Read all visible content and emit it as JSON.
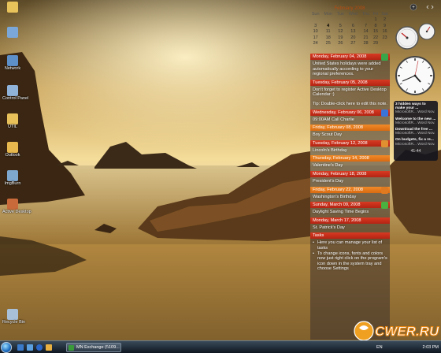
{
  "desktop_icons": [
    {
      "label": "",
      "icon": "user-folder-icon",
      "color": "#e8c25a"
    },
    {
      "label": "",
      "icon": "computer-icon",
      "color": "#7aa7d8"
    },
    {
      "label": "Network",
      "icon": "network-icon",
      "color": "#5d8fc9"
    },
    {
      "label": "Control Panel",
      "icon": "control-panel-icon",
      "color": "#8fb3d9"
    },
    {
      "label": "UTIL",
      "icon": "folder-icon",
      "color": "#e9c15b"
    },
    {
      "label": "Outlook",
      "icon": "outlook-icon",
      "color": "#e6b84e"
    },
    {
      "label": "ImgBurn",
      "icon": "imgburn-icon",
      "color": "#7fa8cf"
    },
    {
      "label": "Active Desktop",
      "icon": "calendar-app-icon",
      "color": "#c86a3a"
    },
    {
      "label": "Recycle Bin",
      "icon": "recycle-bin-icon",
      "color": "#a8c0d8"
    }
  ],
  "calendar": {
    "month_title": "February 2008",
    "weekdays": [
      "Sun",
      "Mon",
      "Tue",
      "Wed",
      "Thu",
      "Fri",
      "Sat"
    ],
    "weeks": [
      [
        "",
        "",
        "",
        "",
        "",
        "1",
        "2"
      ],
      [
        "3",
        "4",
        "5",
        "6",
        "7",
        "8",
        "9"
      ],
      [
        "10",
        "11",
        "12",
        "13",
        "14",
        "15",
        "16"
      ],
      [
        "17",
        "18",
        "19",
        "20",
        "21",
        "22",
        "23"
      ],
      [
        "24",
        "25",
        "26",
        "27",
        "28",
        "29",
        ""
      ]
    ]
  },
  "events": [
    {
      "header": "Monday, February 04, 2008",
      "style": "red",
      "icon_color": "#3aa64a",
      "body": "United States holidays were added automatically according to your regional preferences."
    },
    {
      "header": "Tuesday, February 05, 2008",
      "style": "red",
      "icon_color": "",
      "body": "Don't forget to register Active Desktop Calendar :)"
    },
    {
      "header": "",
      "style": "none",
      "icon_color": "",
      "body": "Tip: Double-click here to edit this note."
    },
    {
      "header": "Wednesday, February 06, 2008",
      "style": "red",
      "icon_color": "#3a74d8",
      "body": "09:00AM Call Charlie"
    },
    {
      "header": "Friday, February 08, 2008",
      "style": "orange",
      "icon_color": "",
      "body": "Boy Scout Day"
    },
    {
      "header": "Tuesday, February 12, 2008",
      "style": "red",
      "icon_color": "#e09030",
      "body": "Lincoln's Birthday"
    },
    {
      "header": "Thursday, February 14, 2008",
      "style": "orange",
      "icon_color": "",
      "body": "Valentine's Day"
    },
    {
      "header": "Monday, February 18, 2008",
      "style": "red",
      "icon_color": "",
      "body": "President's Day"
    },
    {
      "header": "Friday, February 22, 2008",
      "style": "orange",
      "icon_color": "#e07a20",
      "body": "Washington's Birthday"
    },
    {
      "header": "Sunday, March 09, 2008",
      "style": "red",
      "icon_color": "#4ab040",
      "body": "Daylight Saving Time Begins"
    },
    {
      "header": "Monday, March 17, 2008",
      "style": "red",
      "icon_color": "",
      "body": "St. Patrick's Day"
    }
  ],
  "tasks": {
    "header": "Tasks",
    "items": [
      "Here you can manage your list of tasks",
      "To change icons, fonts and colors now just right click on the program's icon down in the system tray and choose Settings"
    ]
  },
  "feeds": {
    "items": [
      {
        "title": "3 hidden ways to make your ...",
        "source": "MicrosoftR...  Word Nov."
      },
      {
        "title": "Welcome to the new ...",
        "source": "MicrosoftR...  Word Nov."
      },
      {
        "title": "Download the free ...",
        "source": "MicrosoftR...  Word Nov."
      },
      {
        "title": "On budgets, fix a re...",
        "source": "MicrosoftR...  Word Nov."
      }
    ],
    "pager": "41-44"
  },
  "taskbar": {
    "task_button": "MN Exchange (\\\\109...",
    "language": "EN",
    "time": "2:03 PM"
  },
  "watermark": "CWER.RU",
  "colors": {
    "event_red": "#c0301a",
    "event_orange": "#e37a1c",
    "calendar_accent": "#b64a10"
  }
}
